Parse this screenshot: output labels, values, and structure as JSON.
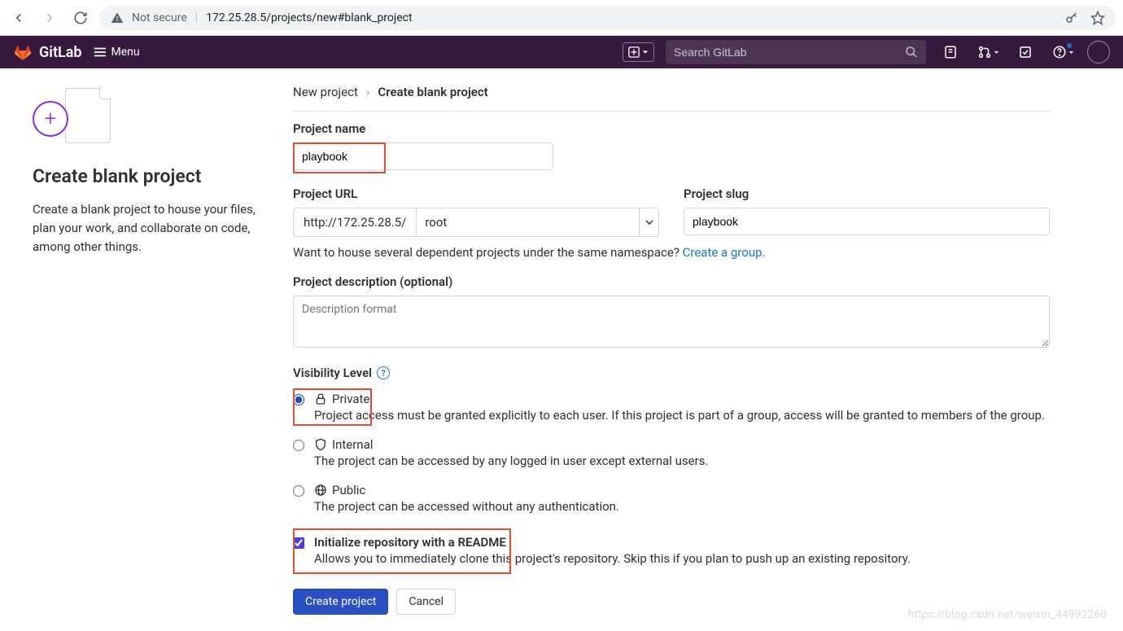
{
  "browser": {
    "security_label": "Not secure",
    "url": "172.25.28.5/projects/new#blank_project"
  },
  "topbar": {
    "brand": "GitLab",
    "menu_label": "Menu",
    "search_placeholder": "Search GitLab"
  },
  "left": {
    "title": "Create blank project",
    "description": "Create a blank project to house your files, plan your work, and collaborate on code, among other things."
  },
  "breadcrumb": {
    "prev": "New project",
    "current": "Create blank project"
  },
  "form": {
    "name_label": "Project name",
    "name_value": "playbook",
    "url_label": "Project URL",
    "url_prefix": "http://172.25.28.5/",
    "url_namespace": "root",
    "slug_label": "Project slug",
    "slug_value": "playbook",
    "namespace_hint": "Want to house several dependent projects under the same namespace? ",
    "namespace_link": "Create a group.",
    "desc_label": "Project description (optional)",
    "desc_placeholder": "Description format",
    "visibility_label": "Visibility Level",
    "visibility": {
      "private": {
        "title": "Private",
        "desc": "Project access must be granted explicitly to each user. If this project is part of a group, access will be granted to members of the group."
      },
      "internal": {
        "title": "Internal",
        "desc": "The project can be accessed by any logged in user except external users."
      },
      "public": {
        "title": "Public",
        "desc": "The project can be accessed without any authentication."
      }
    },
    "readme": {
      "title": "Initialize repository with a README",
      "desc": "Allows you to immediately clone this project's repository. Skip this if you plan to push up an existing repository."
    },
    "submit": "Create project",
    "cancel": "Cancel"
  },
  "watermark": "https://blog.csdn.net/weixin_44992260"
}
